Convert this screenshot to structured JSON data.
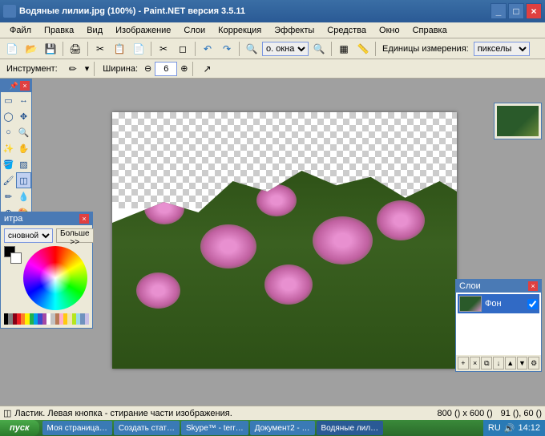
{
  "window": {
    "title": "Водяные лилии.jpg (100%) - Paint.NET версия 3.5.11"
  },
  "menu": {
    "file": "Файл",
    "edit": "Правка",
    "view": "Вид",
    "image": "Изображение",
    "layers": "Слои",
    "adjust": "Коррекция",
    "effects": "Эффекты",
    "tools": "Средства",
    "window": "Окно",
    "help": "Справка"
  },
  "toolbar": {
    "zoom_select": "о. окна",
    "units_label": "Единицы измерения:",
    "units_value": "пикселы"
  },
  "toolbar2": {
    "tool_label": "Инструмент:",
    "width_label": "Ширина:",
    "width_value": "6"
  },
  "colors": {
    "title": "итра",
    "mode": "сновной",
    "more": "Больше >>",
    "palette": [
      "#000",
      "#7f7f7f",
      "#880015",
      "#ed1c24",
      "#ff7f27",
      "#fff200",
      "#22b14c",
      "#00a2e8",
      "#3f48cc",
      "#a349a4",
      "#fff",
      "#c3c3c3",
      "#b97a57",
      "#ffaec9",
      "#ffc90e",
      "#efe4b0",
      "#b5e61d",
      "#99d9ea",
      "#7092be",
      "#c8bfe7"
    ]
  },
  "layers": {
    "title": "Слои",
    "bg_name": "Фон"
  },
  "status": {
    "hint": "Ластик. Левая кнопка - стирание части изображения.",
    "dims": "800 () x 600 ()",
    "coords": "91 (), 60 ()"
  },
  "taskbar": {
    "start": "пуск",
    "items": [
      "Моя страница…",
      "Создать стат…",
      "Skype™ - terr…",
      "Документ2 - …",
      "Водяные лил…"
    ],
    "lang": "RU",
    "time": "14:12"
  }
}
